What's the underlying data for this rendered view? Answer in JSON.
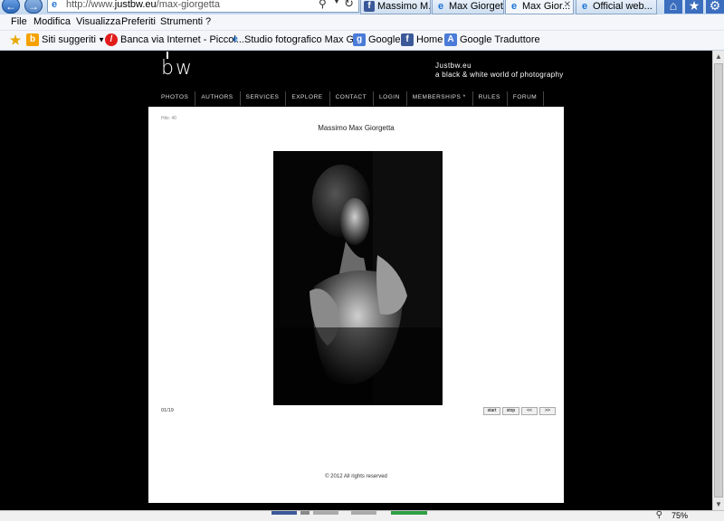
{
  "browser": {
    "url_prefix": "http://www.",
    "url_domain": "justbw.eu",
    "url_path": "/max-giorgetta",
    "tabs": [
      {
        "label": "Massimo M..."
      },
      {
        "label": "Max Giorget..."
      },
      {
        "label": "Max Gior..."
      },
      {
        "label": "Official web..."
      }
    ],
    "menu": [
      "File",
      "Modifica",
      "Visualizza",
      "Preferiti",
      "Strumenti",
      "?"
    ],
    "favorites": [
      {
        "label": "Siti suggeriti"
      },
      {
        "label": "Banca via Internet - Piccol..."
      },
      {
        "label": "Studio fotografico Max Gi..."
      },
      {
        "label": "Google"
      },
      {
        "label": "Home"
      },
      {
        "label": "Google Traduttore"
      }
    ],
    "zoom": "75%"
  },
  "site": {
    "logo": "bw",
    "tagline_title": "Justbw.eu",
    "tagline_sub": "a black & white world of photography",
    "nav": [
      "PHOTOS",
      "AUTHORS",
      "SERVICES",
      "EXPLORE",
      "CONTACT",
      "LOGIN",
      "MEMBERSHIPS *",
      "RULES",
      "FORUM"
    ]
  },
  "gallery": {
    "hits": "Hits: 40",
    "author_name": "Massimo Max Giorgetta",
    "counter": "01/19",
    "buttons": {
      "start": "start",
      "stop": "stop",
      "prev": "<<",
      "next": ">>"
    },
    "copyright": "© 2012    All rights reserved"
  }
}
